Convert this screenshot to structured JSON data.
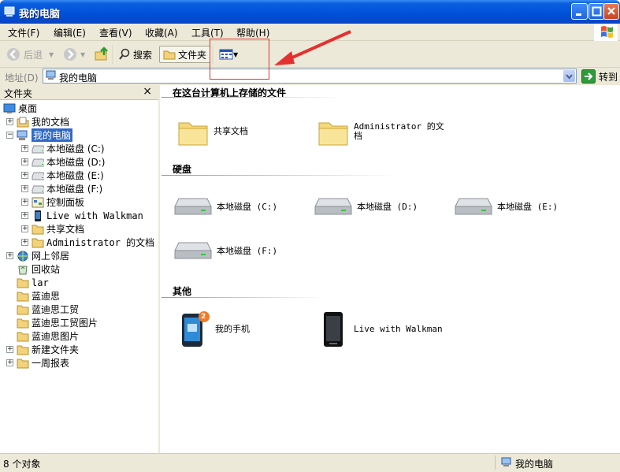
{
  "window": {
    "title": "我的电脑"
  },
  "menu": [
    "文件(F)",
    "编辑(E)",
    "查看(V)",
    "收藏(A)",
    "工具(T)",
    "帮助(H)"
  ],
  "toolbar": {
    "back": "后退",
    "search": "搜索",
    "folders": "文件夹",
    "views_icon": "views-grid-icon"
  },
  "address": {
    "label": "地址(D)",
    "value": "我的电脑",
    "go": "转到"
  },
  "folder_pane": {
    "title": "文件夹",
    "close": "×",
    "tree": [
      {
        "label": "桌面",
        "level": 0,
        "expander": "",
        "icon": "desktop-icon"
      },
      {
        "label": "我的文档",
        "level": 1,
        "expander": "+",
        "icon": "documents-icon"
      },
      {
        "label": "我的电脑",
        "level": 1,
        "expander": "−",
        "icon": "computer-icon",
        "selected": true
      },
      {
        "label": "本地磁盘 (C:)",
        "level": 2,
        "expander": "+",
        "icon": "drive-icon"
      },
      {
        "label": "本地磁盘 (D:)",
        "level": 2,
        "expander": "+",
        "icon": "drive-icon"
      },
      {
        "label": "本地磁盘 (E:)",
        "level": 2,
        "expander": "+",
        "icon": "drive-icon"
      },
      {
        "label": "本地磁盘 (F:)",
        "level": 2,
        "expander": "+",
        "icon": "drive-icon"
      },
      {
        "label": "控制面板",
        "level": 2,
        "expander": "+",
        "icon": "control-panel-icon"
      },
      {
        "label": "Live with Walkman",
        "level": 2,
        "expander": "+",
        "icon": "phone-icon"
      },
      {
        "label": "共享文档",
        "level": 2,
        "expander": "+",
        "icon": "folder-icon"
      },
      {
        "label": "Administrator 的文档",
        "level": 2,
        "expander": "+",
        "icon": "folder-icon"
      },
      {
        "label": "网上邻居",
        "level": 1,
        "expander": "+",
        "icon": "network-icon"
      },
      {
        "label": "回收站",
        "level": 1,
        "expander": "",
        "icon": "recycle-bin-icon"
      },
      {
        "label": "lar",
        "level": 1,
        "expander": "",
        "icon": "folder-icon"
      },
      {
        "label": "蓝迪思",
        "level": 1,
        "expander": "",
        "icon": "folder-icon"
      },
      {
        "label": "蓝迪思工贸",
        "level": 1,
        "expander": "",
        "icon": "folder-icon"
      },
      {
        "label": "蓝迪思工贸图片",
        "level": 1,
        "expander": "",
        "icon": "folder-icon"
      },
      {
        "label": "蓝迪思图片",
        "level": 1,
        "expander": "",
        "icon": "folder-icon"
      },
      {
        "label": "新建文件夹",
        "level": 1,
        "expander": "+",
        "icon": "folder-icon"
      },
      {
        "label": "一周报表",
        "level": 1,
        "expander": "+",
        "icon": "folder-icon"
      }
    ]
  },
  "content": {
    "groups": [
      {
        "title": "在这台计算机上存储的文件",
        "items": [
          "共享文档",
          "Administrator 的文档"
        ]
      },
      {
        "title": "硬盘",
        "items": [
          "本地磁盘 (C:)",
          "本地磁盘 (D:)",
          "本地磁盘 (E:)",
          "本地磁盘 (F:)"
        ]
      },
      {
        "title": "其他",
        "items": [
          "我的手机",
          "Live with Walkman"
        ],
        "badge": "2"
      }
    ]
  },
  "status": {
    "count": "8 个对象",
    "location": "我的电脑"
  },
  "colors": {
    "titlebar": "#0050d8",
    "selection": "#316ac5",
    "chrome": "#ece9d8",
    "annotation": "#e53030"
  }
}
